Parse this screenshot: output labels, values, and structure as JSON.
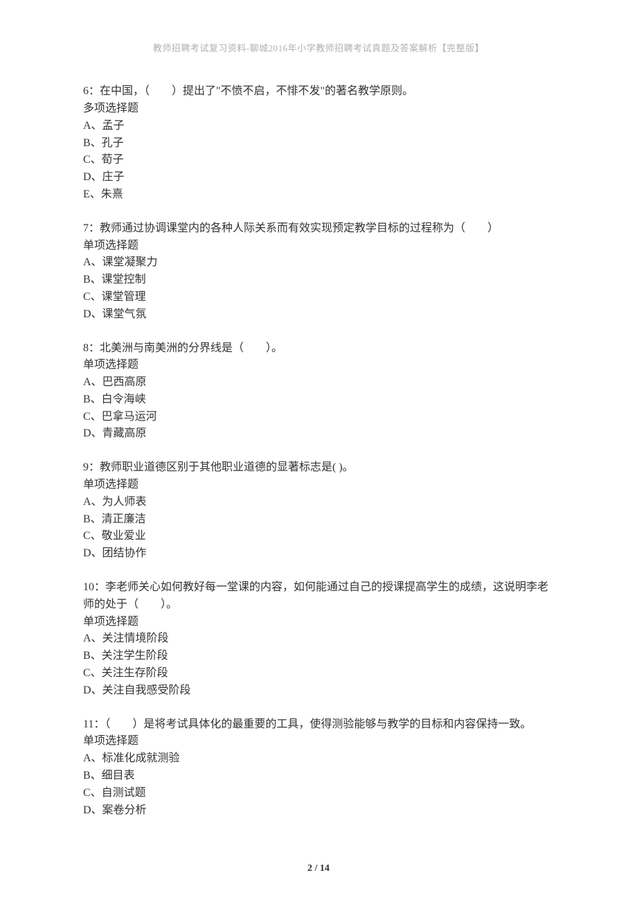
{
  "header": {
    "text": "教师招聘考试复习资料-聊城2016年小学教师招聘考试真题及答案解析【完整版】"
  },
  "questions": [
    {
      "stem": "6：在中国，（　　）提出了\"不愤不启，不悱不发\"的著名教学原则。",
      "type": "多项选择题",
      "options": [
        "A、孟子",
        "B、孔子",
        "C、荀子",
        "D、庄子",
        "E、朱熹"
      ]
    },
    {
      "stem": "7：教师通过协调课堂内的各种人际关系而有效实现预定教学目标的过程称为（　　）",
      "type": "单项选择题",
      "options": [
        "A、课堂凝聚力",
        "B、课堂控制",
        "C、课堂管理",
        "D、课堂气氛"
      ]
    },
    {
      "stem": "8：北美洲与南美洲的分界线是（　　）。",
      "type": "单项选择题",
      "options": [
        "A、巴西高原",
        "B、白令海峡",
        "C、巴拿马运河",
        "D、青藏高原"
      ]
    },
    {
      "stem": "9：教师职业道德区别于其他职业道德的显著标志是( )。",
      "type": "单项选择题",
      "options": [
        "A、为人师表",
        "B、清正廉洁",
        "C、敬业爱业",
        "D、团结协作"
      ]
    },
    {
      "stem": "10：李老师关心如何教好每一堂课的内容，如何能通过自己的授课提高学生的成绩，这说明李老师的处于（　　）。",
      "type": "单项选择题",
      "options": [
        "A、关注情境阶段",
        "B、关注学生阶段",
        "C、关注生存阶段",
        "D、关注自我感受阶段"
      ]
    },
    {
      "stem": "11：（　　）是将考试具体化的最重要的工具，使得测验能够与教学的目标和内容保持一致。",
      "type": "单项选择题",
      "options": [
        "A、标准化成就测验",
        "B、细目表",
        "C、自测试题",
        "D、案卷分析"
      ]
    }
  ],
  "pageNumber": "2 / 14"
}
